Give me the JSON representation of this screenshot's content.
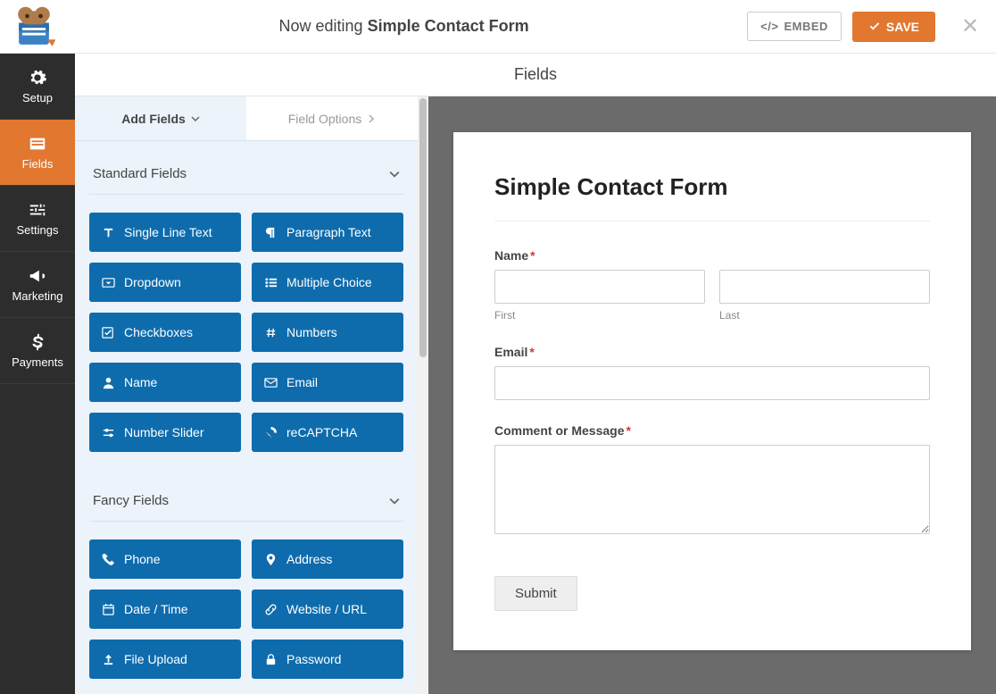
{
  "header": {
    "now_editing_prefix": "Now editing",
    "form_name": "Simple Contact Form",
    "embed_label": "EMBED",
    "save_label": "SAVE"
  },
  "nav": {
    "setup": "Setup",
    "fields": "Fields",
    "settings": "Settings",
    "marketing": "Marketing",
    "payments": "Payments"
  },
  "center_title": "Fields",
  "tabs": {
    "add": "Add Fields",
    "options": "Field Options"
  },
  "sections": {
    "standard": {
      "title": "Standard Fields",
      "fields": [
        "Single Line Text",
        "Paragraph Text",
        "Dropdown",
        "Multiple Choice",
        "Checkboxes",
        "Numbers",
        "Name",
        "Email",
        "Number Slider",
        "reCAPTCHA"
      ]
    },
    "fancy": {
      "title": "Fancy Fields",
      "fields": [
        "Phone",
        "Address",
        "Date / Time",
        "Website / URL",
        "File Upload",
        "Password"
      ]
    }
  },
  "preview": {
    "form_title": "Simple Contact Form",
    "name_label": "Name",
    "first_label": "First",
    "last_label": "Last",
    "email_label": "Email",
    "message_label": "Comment or Message",
    "submit_label": "Submit"
  }
}
